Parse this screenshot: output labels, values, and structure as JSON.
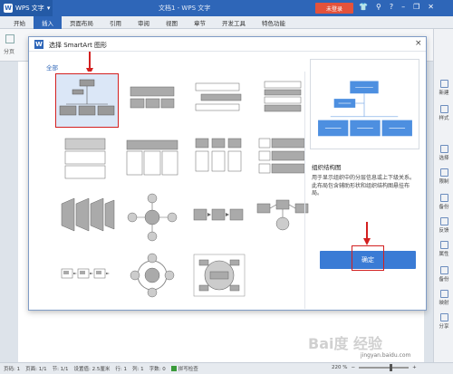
{
  "app": {
    "name": "WPS 文字",
    "logo": "W",
    "doc_title": "文档1 - WPS 文字",
    "login_label": "未登录",
    "window_controls": [
      "shirt-icon",
      "pin-icon",
      "help-icon",
      "minimize-icon",
      "restore-icon",
      "close-icon"
    ]
  },
  "menu": {
    "tabs": [
      {
        "label": "开始",
        "active": false
      },
      {
        "label": "插入",
        "active": true
      },
      {
        "label": "页面布局",
        "active": false
      },
      {
        "label": "引用",
        "active": false
      },
      {
        "label": "审阅",
        "active": false
      },
      {
        "label": "视图",
        "active": false
      },
      {
        "label": "章节",
        "active": false
      },
      {
        "label": "开发工具",
        "active": false
      },
      {
        "label": "特色功能",
        "active": false
      }
    ]
  },
  "ribbon": {
    "partial_label": "分页"
  },
  "dialog": {
    "logo": "W",
    "title": "选择 SmartArt 图形",
    "close": "×",
    "category_tab": "全部",
    "preview": {
      "name": "组织结构图",
      "description": "用于显示组织中的分层信息或上下级关系。此布局包含辅助形状和组织结构图悬挂布局。"
    },
    "ok_label": "确定"
  },
  "taskpane": {
    "items": [
      "新建",
      "样式",
      "选择",
      "限制",
      "备份",
      "反馈",
      "属性",
      "备份",
      "映射",
      "分享"
    ]
  },
  "statusbar": {
    "page_no": "页码: 1",
    "pages": "页面: 1/1",
    "section": "节: 1/1",
    "setting": "设置值: 2.5厘米",
    "row": "行: 1",
    "col": "列: 1",
    "words": "字数: 0",
    "spell": "拼写检查",
    "zoom": "220 %"
  },
  "watermark": {
    "text": "Bai度 经验",
    "url": "jingyan.baidu.com"
  },
  "colors": {
    "accent": "#2e66b8",
    "highlight": "#d32020",
    "ok": "#3a7bd5"
  }
}
